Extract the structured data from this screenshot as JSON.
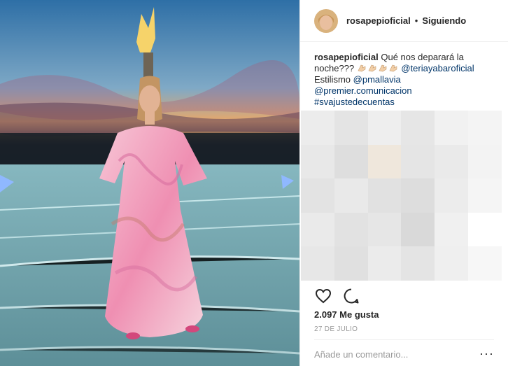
{
  "post": {
    "username": "rosapepioficial",
    "separator": "•",
    "follow_status": "Siguiendo",
    "caption": {
      "user": "rosapepioficial",
      "text": "Qué nos deparará la noche???",
      "emoji_count": 4,
      "mention_1": "@teriayabaroficial",
      "styling_label": "Estilismo",
      "mention_2": "@pmallavia",
      "mention_3": "@premier.comunicacion",
      "hashtag": "#svajustedecuentas"
    },
    "likes": "2.097 Me gusta",
    "date": "27 DE JULIO",
    "comment_placeholder": "Añade un comentario...",
    "more_label": "···"
  },
  "icons": [
    "heart-icon",
    "comment-icon",
    "more-options-icon"
  ],
  "colors": {
    "link": "#003569",
    "text": "#262626",
    "muted": "#999999",
    "divider": "#efefef"
  }
}
